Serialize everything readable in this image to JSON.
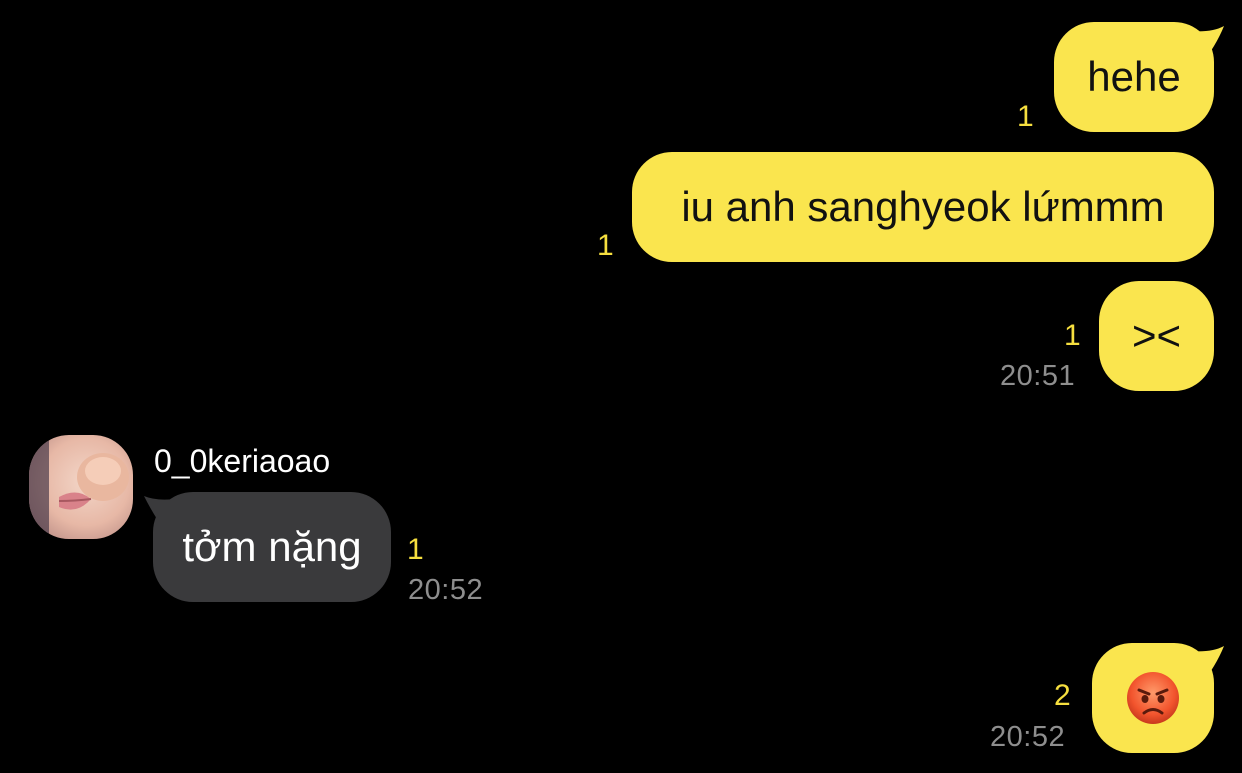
{
  "colors": {
    "background": "#000000",
    "outgoing_bubble": "#fae54e",
    "incoming_bubble": "#3a3a3c",
    "unread_count": "#f6df3f",
    "timestamp": "#8e8e8e"
  },
  "messages": [
    {
      "direction": "outgoing",
      "text": "hehe",
      "unread": "1",
      "time": ""
    },
    {
      "direction": "outgoing",
      "text": "iu anh sanghyeok lứmmm",
      "unread": "1",
      "time": ""
    },
    {
      "direction": "outgoing",
      "text": "><",
      "unread": "1",
      "time": "20:51"
    },
    {
      "direction": "incoming",
      "sender": "0_0keriaoao",
      "text": "tởm nặng",
      "unread": "1",
      "time": "20:52"
    },
    {
      "direction": "outgoing",
      "emoji": "angry-face-icon",
      "unread": "2",
      "time": "20:52"
    }
  ]
}
